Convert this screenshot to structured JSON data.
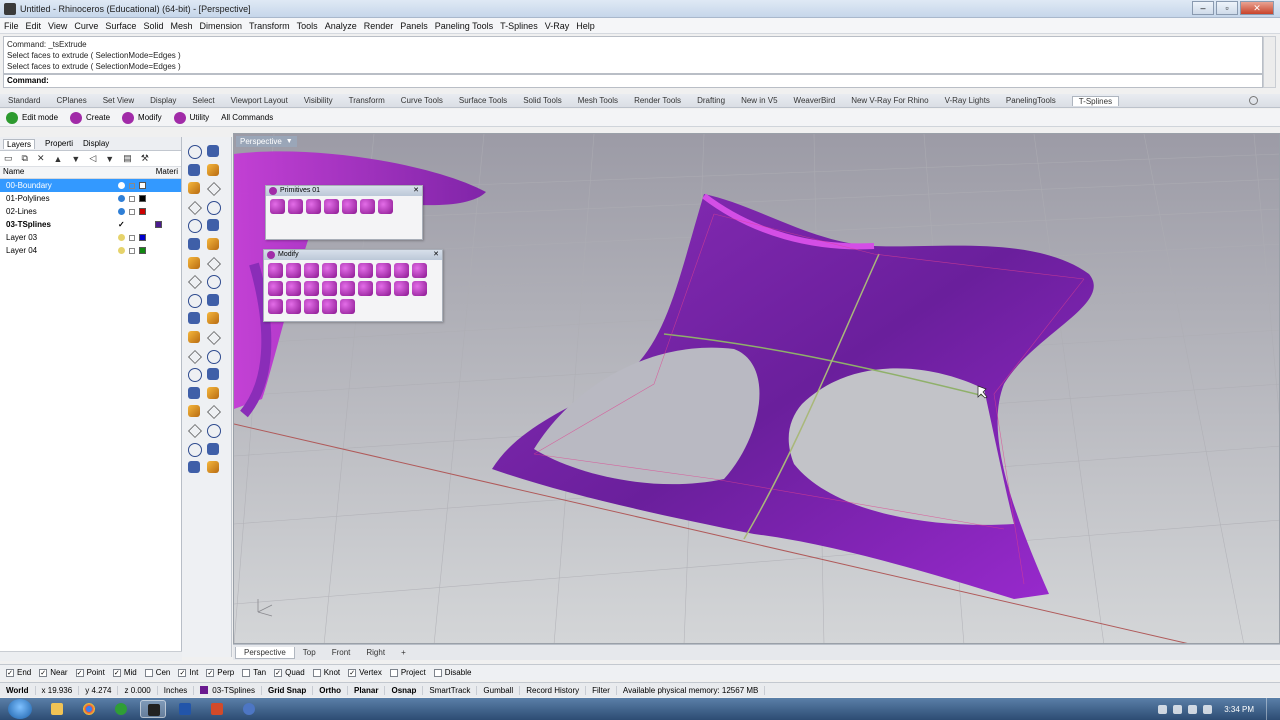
{
  "window": {
    "title": "Untitled - Rhinoceros (Educational) (64-bit) - [Perspective]"
  },
  "menu": [
    "File",
    "Edit",
    "View",
    "Curve",
    "Surface",
    "Solid",
    "Mesh",
    "Dimension",
    "Transform",
    "Tools",
    "Analyze",
    "Render",
    "Panels",
    "Paneling Tools",
    "T-Splines",
    "V-Ray",
    "Help"
  ],
  "command": {
    "history": [
      "Command: _tsExtrude",
      "Select faces to extrude ( SelectionMode=Edges )",
      "Select faces to extrude ( SelectionMode=Edges )"
    ],
    "prompt": "Command:"
  },
  "toolbar_tabs": [
    "Standard",
    "CPlanes",
    "Set View",
    "Display",
    "Select",
    "Viewport Layout",
    "Visibility",
    "Transform",
    "Curve Tools",
    "Surface Tools",
    "Solid Tools",
    "Mesh Tools",
    "Render Tools",
    "Drafting",
    "New in V5",
    "WeaverBird",
    "New V-Ray For Rhino",
    "V-Ray Lights",
    "PanelingTools",
    "T-Splines"
  ],
  "tsplines_toolbar": {
    "edit_mode": "Edit mode",
    "create": "Create",
    "modify": "Modify",
    "utility": "Utility",
    "all_commands": "All Commands"
  },
  "panel": {
    "tabs": [
      "Layers",
      "Properti",
      "Display"
    ],
    "col_name": "Name",
    "col_material": "Materi",
    "layers": [
      {
        "name": "00-Boundary",
        "color": "#ffffff",
        "bulb": "#ffffff",
        "selected": true,
        "current": false
      },
      {
        "name": "01-Polylines",
        "color": "#000000",
        "bulb": "#2f7fd6",
        "selected": false,
        "current": false
      },
      {
        "name": "02-Lines",
        "color": "#cc0000",
        "bulb": "#2f7fd6",
        "selected": false,
        "current": false
      },
      {
        "name": "03-TSplines",
        "color": "#4b1b8f",
        "bulb": "#ffffff",
        "selected": false,
        "current": true
      },
      {
        "name": "Layer 03",
        "color": "#0000cc",
        "bulb": "#e6d36b",
        "selected": false,
        "current": false
      },
      {
        "name": "Layer 04",
        "color": "#118811",
        "bulb": "#e6d36b",
        "selected": false,
        "current": false
      }
    ]
  },
  "viewport": {
    "label": "Perspective"
  },
  "floating": {
    "primitives_title": "Primitives 01",
    "modify_title": "Modify"
  },
  "view_tabs": [
    "Perspective",
    "Top",
    "Front",
    "Right"
  ],
  "osnaps": [
    {
      "label": "End",
      "on": true
    },
    {
      "label": "Near",
      "on": true
    },
    {
      "label": "Point",
      "on": true
    },
    {
      "label": "Mid",
      "on": true
    },
    {
      "label": "Cen",
      "on": false
    },
    {
      "label": "Int",
      "on": true
    },
    {
      "label": "Perp",
      "on": true
    },
    {
      "label": "Tan",
      "on": false
    },
    {
      "label": "Quad",
      "on": true
    },
    {
      "label": "Knot",
      "on": false
    },
    {
      "label": "Vertex",
      "on": true
    },
    {
      "label": "Project",
      "on": false
    },
    {
      "label": "Disable",
      "on": false
    }
  ],
  "status": {
    "cplane": "World",
    "x": "x 19.936",
    "y": "y 4.274",
    "z": "z 0.000",
    "units": "Inches",
    "layer": "03-TSplines",
    "grid_snap": "Grid Snap",
    "ortho": "Ortho",
    "planar": "Planar",
    "osnap": "Osnap",
    "smarttrack": "SmartTrack",
    "gumball": "Gumball",
    "record_history": "Record History",
    "filter": "Filter",
    "memory": "Available physical memory: 12567 MB"
  },
  "taskbar": {
    "clock": "3:34 PM"
  }
}
